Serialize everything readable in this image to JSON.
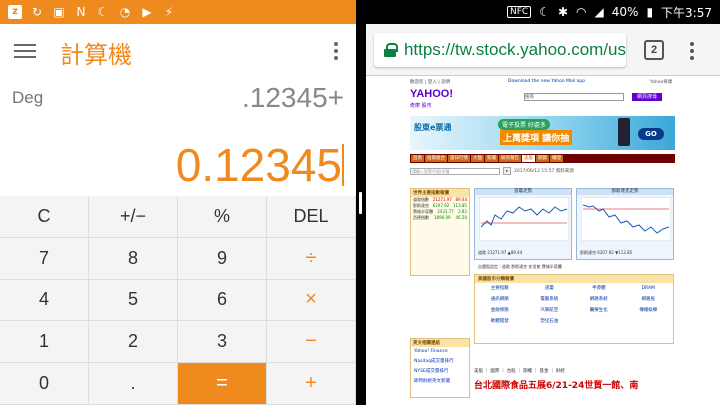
{
  "left_status_icons": [
    "notification-icon",
    "sync-icon",
    "image-icon",
    "n-icon",
    "moon-icon",
    "hotspot-icon",
    "signal-icon",
    "app-icon"
  ],
  "calculator": {
    "title": "計算機",
    "angle_mode": "Deg",
    "expression": ".12345+",
    "result": "0.12345",
    "accent_color": "#ef8a1e",
    "keys": [
      {
        "label": "C",
        "name": "clear",
        "kind": "fn"
      },
      {
        "label": "+/−",
        "name": "negate",
        "kind": "fn"
      },
      {
        "label": "%",
        "name": "percent",
        "kind": "fn"
      },
      {
        "label": "DEL",
        "name": "delete",
        "kind": "fn"
      },
      {
        "label": "7",
        "name": "seven",
        "kind": "digit"
      },
      {
        "label": "8",
        "name": "eight",
        "kind": "digit"
      },
      {
        "label": "9",
        "name": "nine",
        "kind": "digit"
      },
      {
        "label": "÷",
        "name": "divide",
        "kind": "op"
      },
      {
        "label": "4",
        "name": "four",
        "kind": "digit"
      },
      {
        "label": "5",
        "name": "five",
        "kind": "digit"
      },
      {
        "label": "6",
        "name": "six",
        "kind": "digit"
      },
      {
        "label": "×",
        "name": "multiply",
        "kind": "op"
      },
      {
        "label": "1",
        "name": "one",
        "kind": "digit"
      },
      {
        "label": "2",
        "name": "two",
        "kind": "digit"
      },
      {
        "label": "3",
        "name": "three",
        "kind": "digit"
      },
      {
        "label": "−",
        "name": "subtract",
        "kind": "op"
      },
      {
        "label": "0",
        "name": "zero",
        "kind": "digit"
      },
      {
        "label": ".",
        "name": "decimal",
        "kind": "digit"
      },
      {
        "label": "=",
        "name": "equals",
        "kind": "eq"
      },
      {
        "label": "+",
        "name": "add",
        "kind": "op"
      }
    ]
  },
  "right_status": {
    "nfc": "NFC",
    "battery": "40%",
    "time": "下午3:57"
  },
  "chrome": {
    "url": "https://tw.stock.yahoo.com/us",
    "tab_count": "2",
    "secure_color": "#0b8043"
  },
  "webpage": {
    "topbar_links": "歡迎您 | 登入 | 說明",
    "topbar_ad": "Download the new Yahoo Mail app",
    "topbar_home": "Yahoo奇摩",
    "logo": "YAHOO!",
    "logo_sub": "奇摩 股市",
    "search_placeholder": "搜尋",
    "search_button": "網頁搜尋",
    "banner": {
      "brand": "股東e票通",
      "pill": "電子投票 好處多",
      "headline": "上萬獎項 讓你抽",
      "go": "GO"
    },
    "nav_tabs": [
      {
        "label": "首頁",
        "selected": false
      },
      {
        "label": "投資組合",
        "selected": false
      },
      {
        "label": "當日行情",
        "selected": false
      },
      {
        "label": "大盤",
        "selected": false
      },
      {
        "label": "新聞",
        "selected": false
      },
      {
        "label": "研究報告",
        "selected": false
      },
      {
        "label": "美股",
        "selected": true
      },
      {
        "label": "期貨",
        "selected": false
      },
      {
        "label": "權證",
        "selected": false
      }
    ],
    "stock_input": "請輸入股票代號/名稱",
    "search_row_note": "2017/06/12 15:57 資料來源",
    "intl": {
      "title": "世界主要指數報價",
      "rows": [
        {
          "name": "道瓊指數",
          "value": "21271.97",
          "change": "89.44",
          "dir": "up"
        },
        {
          "name": "那斯達克",
          "value": "6207.92",
          "change": "113.85",
          "dir": "dn"
        },
        {
          "name": "費城半導體",
          "value": "2431.77",
          "change": "2.82",
          "dir": "dn"
        },
        {
          "name": "西德指數",
          "value": "1896.09",
          "change": "46.20",
          "dir": "dn"
        }
      ]
    },
    "chart_left": {
      "title": "道瓊走勢",
      "caption": "道瓊 21271.97 ▲89.44"
    },
    "chart_right": {
      "title": "那斯達克走勢",
      "caption": "那斯達克 6207.92 ▼113.85"
    },
    "chart_options": "自選股設定 : 道瓊  那斯達克  史坦普  費城半導體",
    "sector": {
      "title": "美國股市分類報價",
      "cells": [
        "主要指數",
        "道瓊",
        "半導體",
        "DRAM",
        "通訊網路",
        "電腦系統",
        "網路系統",
        "網路股",
        "金融保險",
        "汽車航空",
        "醫療生化",
        "傳播娛樂",
        "軟體開發",
        "塑化石油",
        "",
        ""
      ]
    },
    "en_links": {
      "title": "英文相關連結",
      "items": [
        "Yahoo! Finance",
        "Nasdaq成交量排行",
        "NYSE成交量排行",
        "即時財經英文新聞"
      ]
    },
    "news_tabs": "美股 ｜ 國際 ｜ 台股 ｜ 期權 ｜ 基金 ｜ 財經",
    "headline": "台北國際食品五展6/21-24世貿一館、南"
  }
}
